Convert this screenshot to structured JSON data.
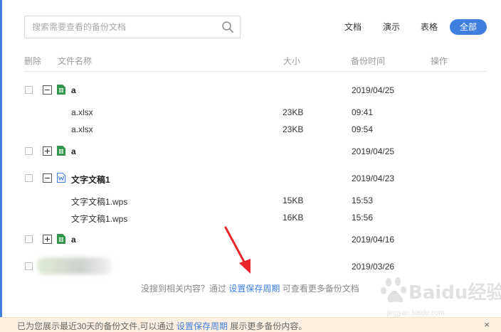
{
  "search": {
    "placeholder": "搜索需要查看的备份文档"
  },
  "filters": [
    "文档",
    "演示",
    "表格",
    "全部"
  ],
  "columns": {
    "delete": "删除",
    "name": "文件名称",
    "size": "大小",
    "time": "备份时间",
    "action": "操作"
  },
  "groups": [
    {
      "name": "a",
      "date": "2019/04/25",
      "type": "sheet",
      "expanded": true,
      "files": [
        {
          "name": "a.xlsx",
          "size": "23KB",
          "time": "09:41"
        },
        {
          "name": "a.xlsx",
          "size": "23KB",
          "time": "09:54"
        }
      ]
    },
    {
      "name": "a",
      "date": "2019/04/25",
      "type": "sheet",
      "expanded": false,
      "files": []
    },
    {
      "name": "文字文稿1",
      "date": "2019/04/23",
      "type": "doc",
      "expanded": true,
      "files": [
        {
          "name": "文字文稿1.wps",
          "size": "15KB",
          "time": "15:53"
        },
        {
          "name": "文字文稿1.wps",
          "size": "16KB",
          "time": "15:56"
        }
      ]
    },
    {
      "name": "a",
      "date": "2019/04/16",
      "type": "sheet",
      "expanded": false,
      "files": []
    },
    {
      "name": "",
      "date": "2019/03/26",
      "type": "blurred",
      "expanded": false,
      "files": []
    }
  ],
  "hint": {
    "prefix": "没搜到相关内容？通过",
    "link": "设置保存周期",
    "suffix": "可查看更多备份文档"
  },
  "bottom_bar": {
    "prefix": "已为您展示最近30天的备份文件,可以通过",
    "link": "设置保存周期",
    "suffix": "展示更多备份内容。",
    "close": "×"
  },
  "watermark": {
    "brand": "Baidu经验",
    "url": "jingyan.baidu.com"
  },
  "colors": {
    "accent": "#3f7fe0",
    "sheet_icon": "#2e9b4a",
    "doc_icon": "#3f7fe0",
    "annotation_arrow": "#e8262b",
    "notice_bg": "#fdf0e1"
  },
  "icons": {
    "search": "search-icon",
    "expand": "plus-square-icon",
    "collapse": "minus-square-icon",
    "sheet": "spreadsheet-file-icon",
    "doc": "document-file-icon"
  }
}
